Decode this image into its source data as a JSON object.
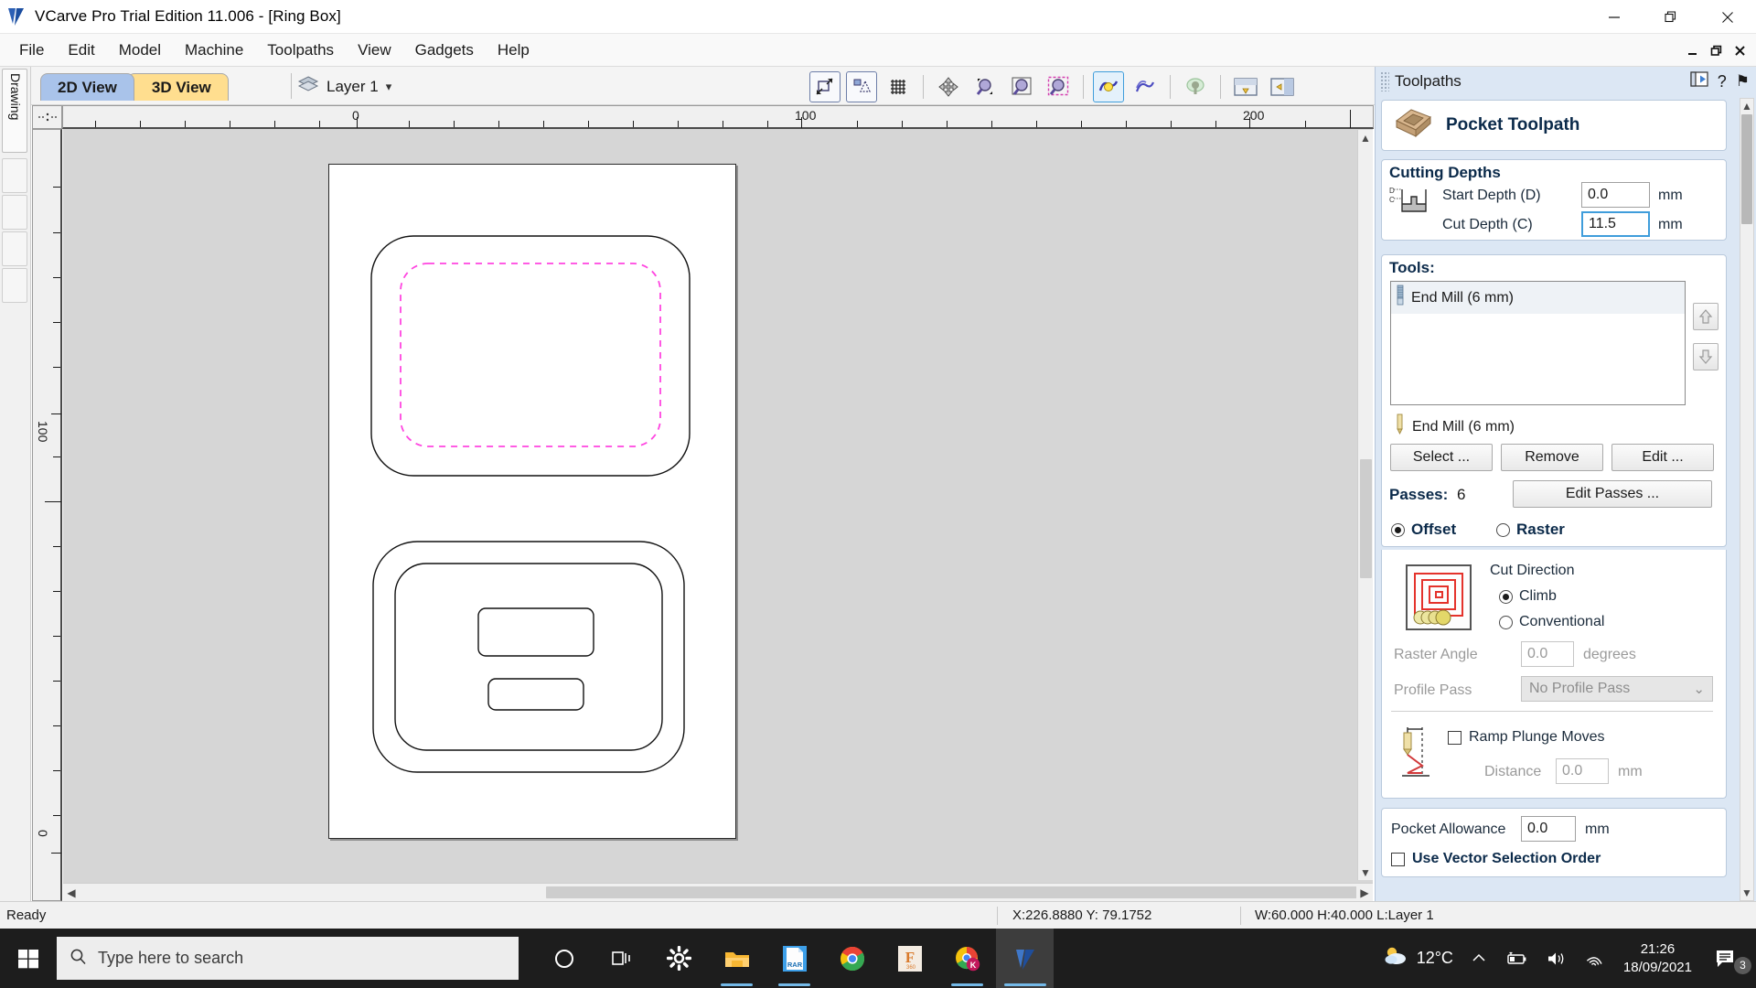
{
  "window": {
    "title": "VCarve Pro Trial Edition 11.006 - [Ring Box]",
    "app_icon": "vcarve-logo-icon",
    "minimize": "—",
    "restore": "❐",
    "close": "✕",
    "mdi_minimize": "_",
    "mdi_restore": "❐",
    "mdi_close": "✕"
  },
  "menubar": {
    "items": [
      {
        "label": "File"
      },
      {
        "label": "Edit"
      },
      {
        "label": "Model"
      },
      {
        "label": "Machine"
      },
      {
        "label": "Toolpaths"
      },
      {
        "label": "View"
      },
      {
        "label": "Gadgets"
      },
      {
        "label": "Help"
      }
    ]
  },
  "sidebar": {
    "tab_label": "Drawing"
  },
  "view_tabs": [
    {
      "label": "2D View",
      "active": true
    },
    {
      "label": "3D View",
      "active": false
    }
  ],
  "layer": {
    "icon": "layers-icon",
    "name": "Layer 1",
    "dropdown_glyph": "▾"
  },
  "toolbar": {
    "icons": [
      {
        "name": "zoom-to-drawing-icon"
      },
      {
        "name": "zoom-to-selection-icon"
      },
      {
        "name": "toggle-grid-icon"
      },
      {
        "name": "pan-view-icon"
      },
      {
        "name": "zoom-extents-icon"
      },
      {
        "name": "zoom-box-icon"
      },
      {
        "name": "zoom-selected-icon"
      },
      {
        "name": "toolpath-preview-icon"
      },
      {
        "name": "toolpath-list-icon"
      },
      {
        "name": "3d-model-icon"
      },
      {
        "name": "panel-layout-horizontal-icon"
      },
      {
        "name": "panel-layout-vertical-icon"
      }
    ]
  },
  "ruler": {
    "h_labels": [
      "0",
      "100",
      "200"
    ],
    "v_labels": [
      "100",
      "0"
    ],
    "units": "mm"
  },
  "toolpaths_panel": {
    "title": "Toolpaths",
    "header_icons": [
      {
        "name": "dock-panel-icon",
        "glyph": ""
      },
      {
        "name": "help-icon",
        "glyph": "?"
      },
      {
        "name": "pin-panel-icon",
        "glyph": "⚑"
      }
    ],
    "toolpath_name": "Pocket Toolpath",
    "toolpath_icon": "pocket-toolpath-icon",
    "cutting_depths": {
      "group_label": "Cutting Depths",
      "diagram_icon": "cut-depth-diagram-icon",
      "start_depth_label": "Start Depth (D)",
      "start_depth_value": "0.0",
      "start_depth_unit": "mm",
      "cut_depth_label": "Cut Depth (C)",
      "cut_depth_value": "11.5",
      "cut_depth_unit": "mm"
    },
    "tools": {
      "group_label": "Tools:",
      "list": [
        {
          "label": "End Mill (6 mm)",
          "icon": "end-mill-icon",
          "selected": true
        }
      ],
      "move_up_glyph": "⇧",
      "move_down_glyph": "⇩",
      "current_tool_label": "End Mill (6 mm)",
      "current_tool_icon": "end-mill-small-icon",
      "select_button": "Select ...",
      "remove_button": "Remove",
      "edit_button": "Edit ..."
    },
    "passes": {
      "label": "Passes:",
      "value": "6",
      "edit_button": "Edit Passes ..."
    },
    "strategy": {
      "offset_label": "Offset",
      "offset_selected": true,
      "raster_label": "Raster",
      "raster_selected": false,
      "preview_icon": "offset-pattern-icon",
      "cut_direction_label": "Cut Direction",
      "climb_label": "Climb",
      "climb_selected": true,
      "conventional_label": "Conventional",
      "conventional_selected": false,
      "raster_angle_label": "Raster Angle",
      "raster_angle_value": "0.0",
      "raster_angle_unit": "degrees",
      "profile_pass_label": "Profile Pass",
      "profile_pass_value": "No Profile Pass",
      "profile_pass_arrow": "⌄"
    },
    "ramp": {
      "diagram_icon": "ramp-plunge-diagram-icon",
      "checkbox_label": "Ramp Plunge Moves",
      "checked": false,
      "distance_label": "Distance",
      "distance_value": "0.0",
      "distance_unit": "mm"
    },
    "pocket": {
      "allowance_label": "Pocket Allowance",
      "allowance_value": "0.0",
      "allowance_unit": "mm",
      "vector_order_label": "Use Vector Selection Order",
      "vector_order_checked": false
    }
  },
  "statusbar": {
    "ready": "Ready",
    "coords": "X:226.8880 Y: 79.1752",
    "dimensions": "W:60.000  H:40.000  L:Layer 1"
  },
  "taskbar": {
    "start_icon": "windows-start-icon",
    "search_icon": "search-icon",
    "search_placeholder": "Type here to search",
    "apps": [
      {
        "name": "cortana-icon",
        "active": false,
        "running": false
      },
      {
        "name": "task-view-icon",
        "active": false,
        "running": false
      },
      {
        "name": "settings-gear-icon",
        "active": false,
        "running": false
      },
      {
        "name": "file-explorer-icon",
        "active": false,
        "running": true
      },
      {
        "name": "winrar-icon",
        "active": false,
        "running": true
      },
      {
        "name": "chrome-icon",
        "active": false,
        "running": false
      },
      {
        "name": "fusion360-icon",
        "active": false,
        "running": false
      },
      {
        "name": "chrome-kotlin-icon",
        "active": false,
        "running": true
      },
      {
        "name": "vcarve-pro-icon",
        "active": true,
        "running": true
      }
    ],
    "tray": {
      "weather_icon": "weather-partly-cloudy-icon",
      "temperature": "12°C",
      "chevron_glyph": "⌃",
      "battery_icon": "battery-charging-icon",
      "volume_icon": "volume-icon",
      "wifi_icon": "wifi-icon",
      "time": "21:26",
      "date": "18/09/2021",
      "notifications_icon": "notifications-icon",
      "notifications_count": "3"
    }
  },
  "colors": {
    "accent_blue": "#a9c3ea",
    "tab_yellow": "#ffde8f",
    "panel_bg": "#dce7f4",
    "group_title": "#0b2a4a",
    "toolpath_magenta": "#ff45e0",
    "focus_border": "#3f9ddb",
    "taskbar_bg": "#1d1d1d"
  }
}
